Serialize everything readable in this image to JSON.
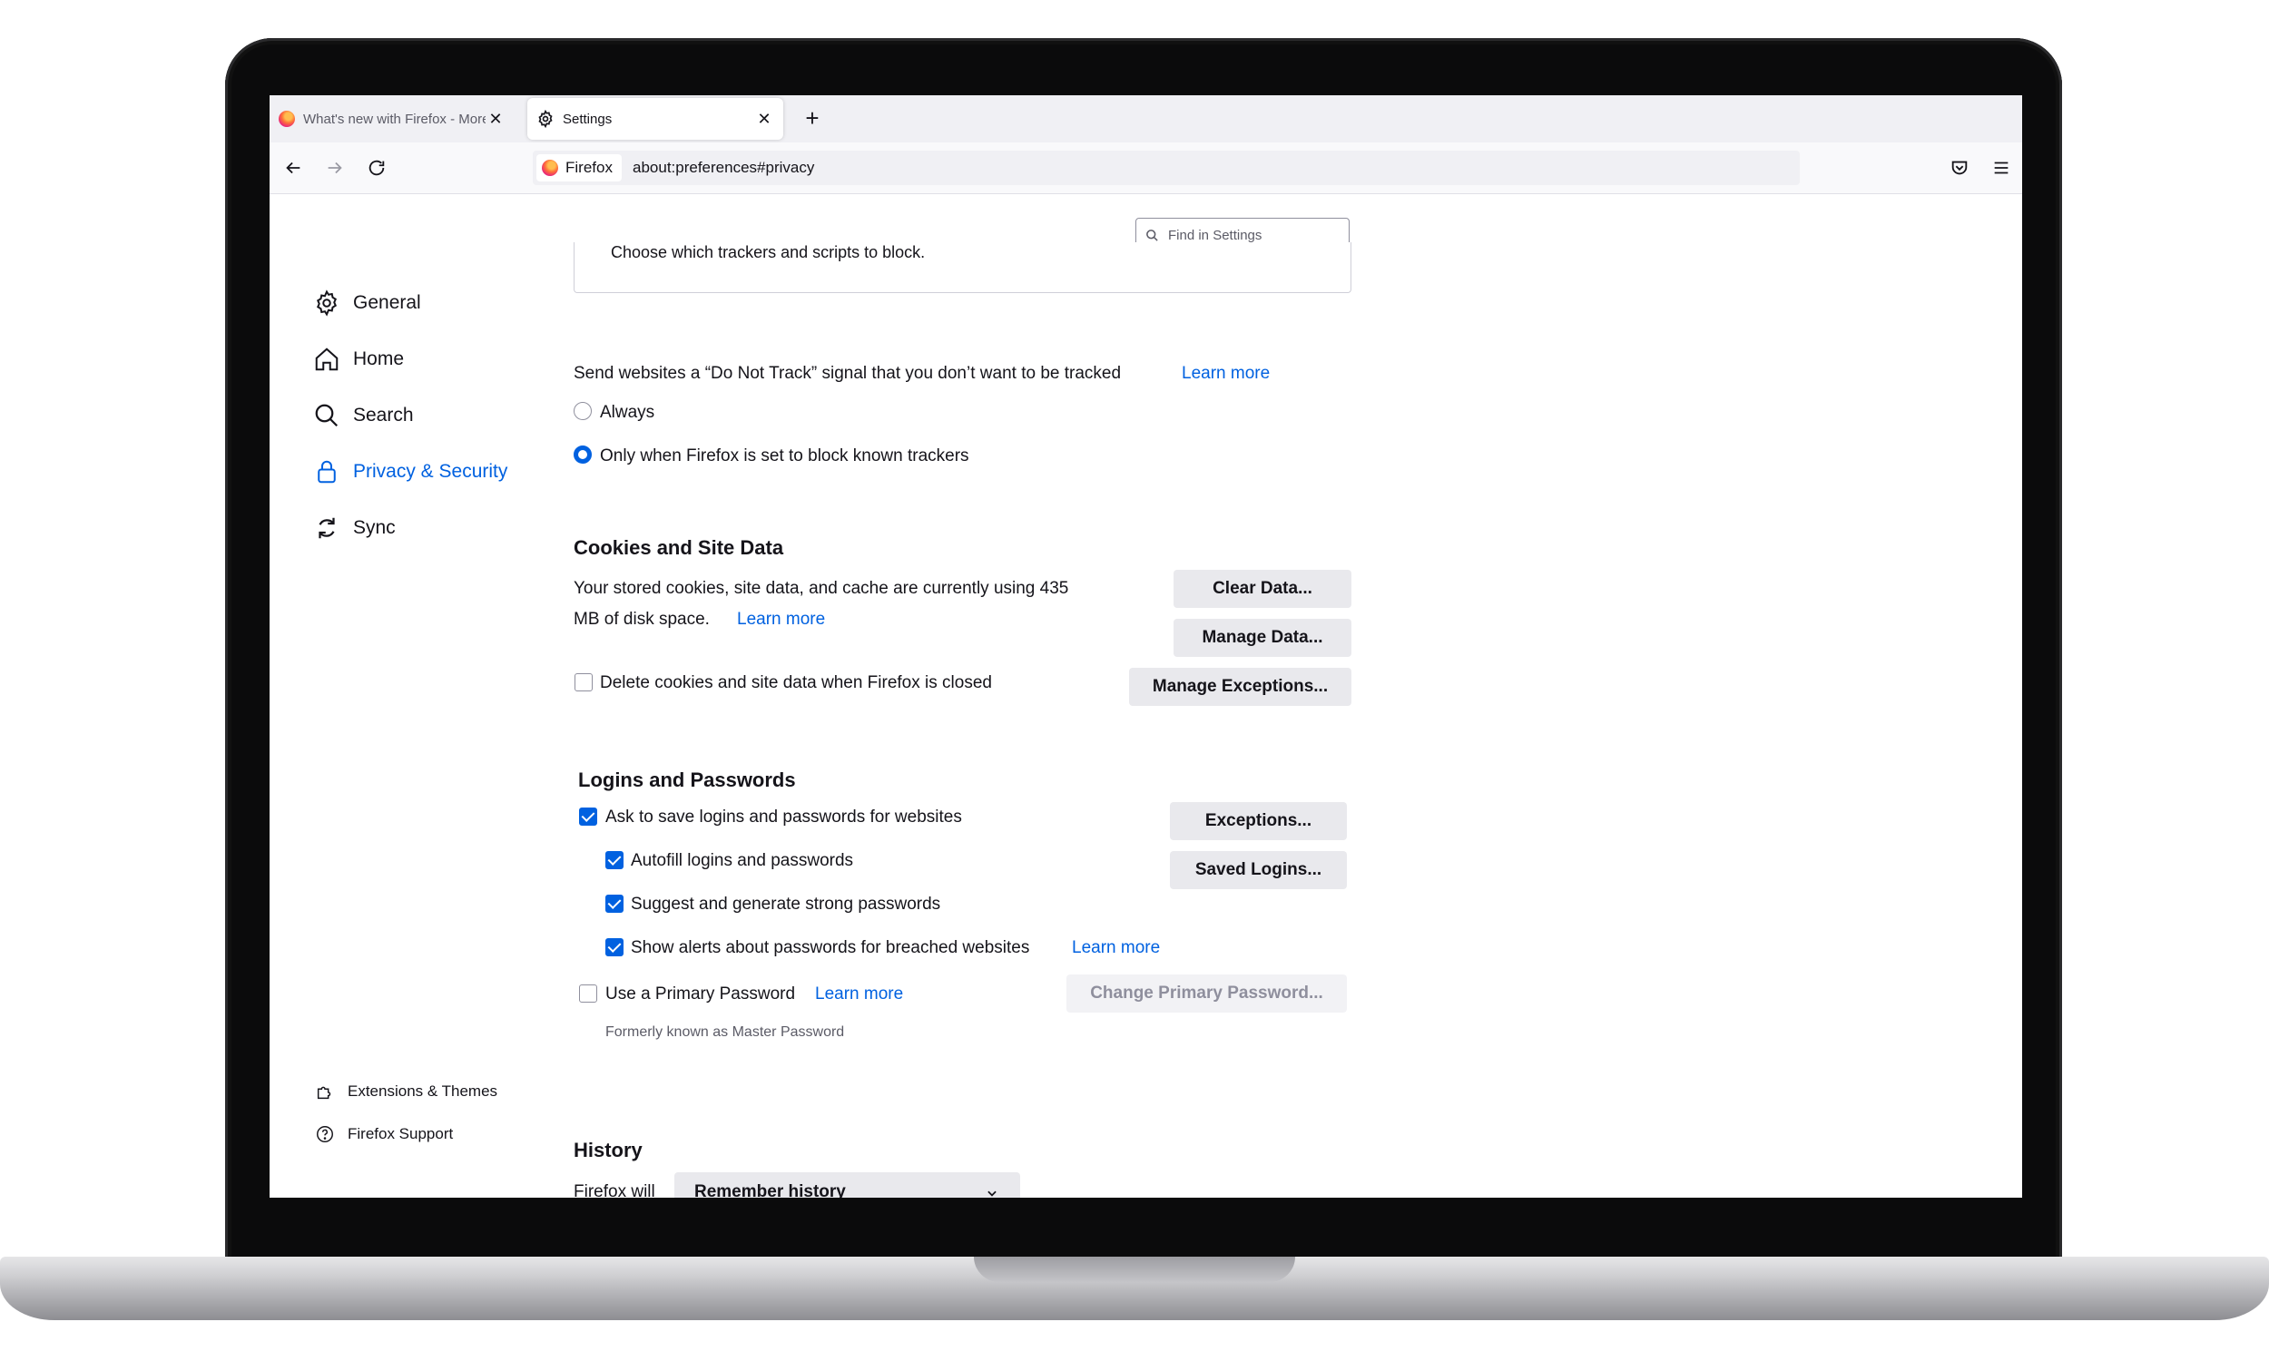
{
  "browser": {
    "tabs": [
      {
        "title": "What's new with Firefox - More"
      },
      {
        "title": "Settings"
      }
    ],
    "identity_label": "Firefox",
    "url": "about:preferences#privacy"
  },
  "search": {
    "placeholder": "Find in Settings"
  },
  "sidebar": {
    "items": [
      {
        "label": "General",
        "icon": "gear-icon"
      },
      {
        "label": "Home",
        "icon": "home-icon"
      },
      {
        "label": "Search",
        "icon": "search-icon"
      },
      {
        "label": "Privacy & Security",
        "icon": "lock-icon",
        "selected": true
      },
      {
        "label": "Sync",
        "icon": "sync-icon"
      }
    ],
    "footer": [
      {
        "label": "Extensions & Themes",
        "icon": "puzzle-icon"
      },
      {
        "label": "Firefox Support",
        "icon": "help-icon"
      }
    ]
  },
  "tracking": {
    "box_text": "Choose which trackers and scripts to block."
  },
  "dnt": {
    "text": "Send websites a “Do Not Track” signal that you don’t want to be tracked",
    "learn_more": "Learn more",
    "options": [
      {
        "label": "Always",
        "selected": false
      },
      {
        "label": "Only when Firefox is set to block known trackers",
        "selected": true
      }
    ]
  },
  "cookies": {
    "heading": "Cookies and Site Data",
    "line1": "Your stored cookies, site data, and cache are currently using 435",
    "line2": "MB of disk space.",
    "learn_more": "Learn more",
    "delete_label": "Delete cookies and site data when Firefox is closed",
    "delete_checked": false,
    "buttons": {
      "clear": "Clear Data...",
      "manage": "Manage Data...",
      "exceptions": "Manage Exceptions..."
    }
  },
  "logins": {
    "heading": "Logins and Passwords",
    "ask": {
      "label": "Ask to save logins and passwords for websites",
      "checked": true
    },
    "autofill": {
      "label": "Autofill logins and passwords",
      "checked": true
    },
    "suggest": {
      "label": "Suggest and generate strong passwords",
      "checked": true
    },
    "alerts": {
      "label": "Show alerts about passwords for breached websites",
      "checked": true
    },
    "alerts_learn_more": "Learn more",
    "primary": {
      "label": "Use a Primary Password",
      "checked": false
    },
    "primary_learn_more": "Learn more",
    "primary_note": "Formerly known as Master Password",
    "buttons": {
      "exceptions": "Exceptions...",
      "saved": "Saved Logins...",
      "change_primary": "Change Primary Password..."
    }
  },
  "history": {
    "heading": "History",
    "label": "Firefox will",
    "select_value": "Remember history"
  },
  "colors": {
    "accent": "#0061e0",
    "button": "#e9e9ed"
  }
}
